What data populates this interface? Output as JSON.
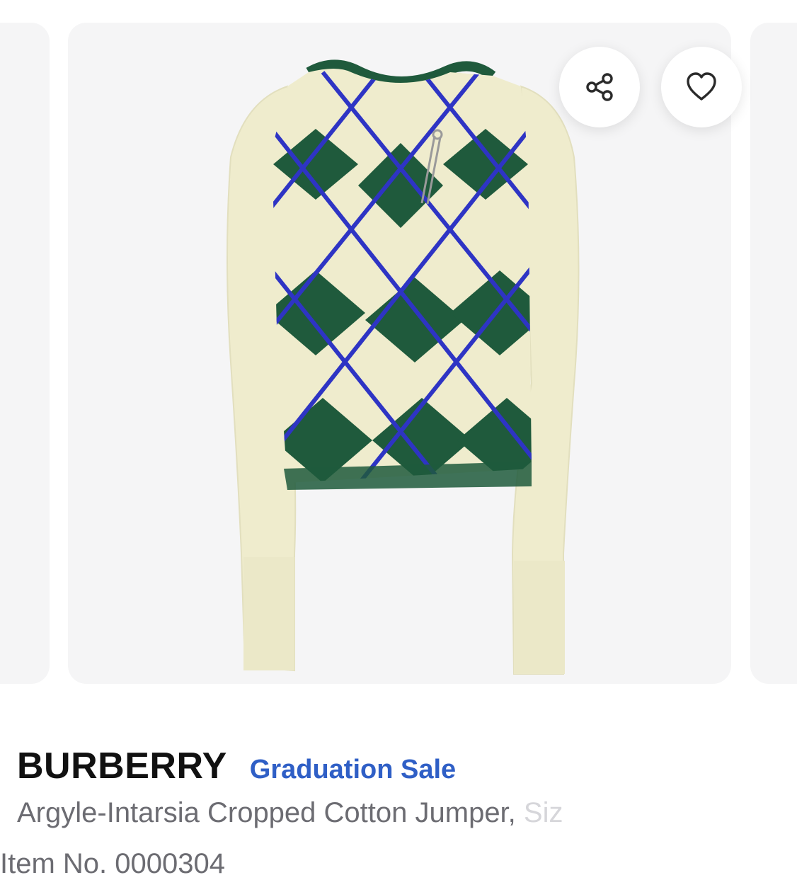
{
  "product": {
    "brand": "BURBERRY",
    "promo_label": "Graduation Sale",
    "description": "Argyle-Intarsia Cropped Cotton Jumper,",
    "description_faded": " Siz",
    "item_number": "Item No. 0000304"
  },
  "actions": {
    "share_icon": "share-icon",
    "favorite_icon": "heart-icon"
  },
  "colors": {
    "brand_text": "#111111",
    "promo_text": "#2f5fc6",
    "secondary_text": "#6c6c72",
    "card_background": "#f5f5f6",
    "sweater_cream": "#efeccd",
    "argyle_green": "#1f5a3c",
    "argyle_blue": "#2e34c4"
  }
}
